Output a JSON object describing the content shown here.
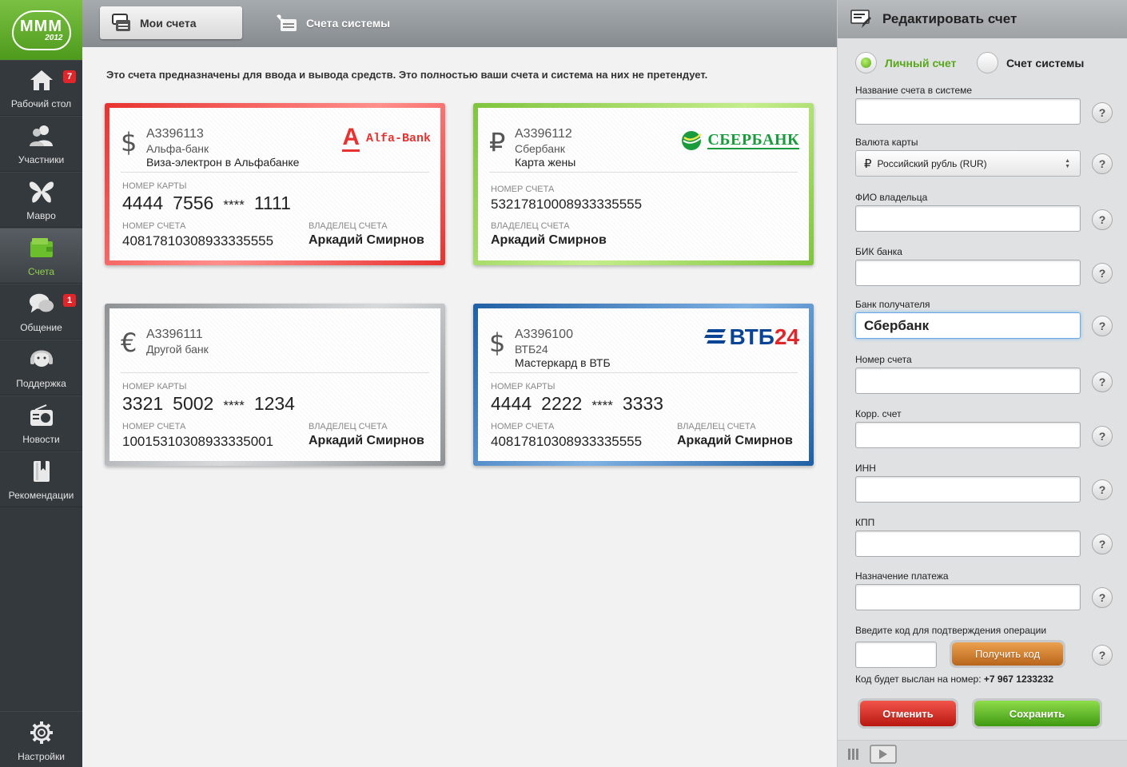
{
  "logo": {
    "text": "МММ",
    "year": "2012"
  },
  "sidebar": {
    "items": [
      {
        "label": "Рабочий стол",
        "icon": "home-icon",
        "badge": "7"
      },
      {
        "label": "Участники",
        "icon": "users-icon",
        "badge": ""
      },
      {
        "label": "Мавро",
        "icon": "butterfly-icon",
        "badge": ""
      },
      {
        "label": "Счета",
        "icon": "wallet-icon",
        "badge": ""
      },
      {
        "label": "Общение",
        "icon": "chat-icon",
        "badge": "1"
      },
      {
        "label": "Поддержка",
        "icon": "headset-icon",
        "badge": ""
      },
      {
        "label": "Новости",
        "icon": "radio-icon",
        "badge": ""
      },
      {
        "label": "Рекомендации",
        "icon": "book-icon",
        "badge": ""
      }
    ],
    "settings_label": "Настройки"
  },
  "tabs": {
    "my": "Мои счета",
    "system": "Счета системы"
  },
  "intro": "Это счета предназначены для ввода и вывода средств. Это полностью ваши счета и система на них не претендует.",
  "cards": {
    "alfa": {
      "currency": "$",
      "id": "A3396113",
      "bank": "Альфа-банк",
      "desc": "Виза-электрон в Альфабанке",
      "card_label": "НОМЕР КАРТЫ",
      "card_number": [
        "4444",
        "7556",
        "****",
        "1111"
      ],
      "account_label": "НОМЕР СЧЕТА",
      "account_number": "40817810308933335555",
      "owner_label": "ВЛАДЕЛЕЦ СЧЕТА",
      "owner": "Аркадий Смирнов",
      "logo_letter": "A",
      "logo_text": "Alfa-Bank",
      "logo_color": "#e8322f"
    },
    "sber": {
      "currency": "₽",
      "id": "A3396112",
      "bank": "Сбербанк",
      "desc": "Карта жены",
      "account_label": "НОМЕР СЧЕТА",
      "account_number": "53217810008933335555",
      "owner_label": "ВЛАДЕЛЕЦ СЧЕТА",
      "owner": "Аркадий Смирнов",
      "logo_text": "СБЕРБАНК",
      "logo_color": "#1a9c3e"
    },
    "other": {
      "currency": "€",
      "id": "A3396111",
      "bank": "Другой банк",
      "card_label": "НОМЕР КАРТЫ",
      "card_number": [
        "3321",
        "5002",
        "****",
        "1234"
      ],
      "account_label": "НОМЕР СЧЕТА",
      "account_number": "10015310308933335001",
      "owner_label": "ВЛАДЕЛЕЦ СЧЕТА",
      "owner": "Аркадий Смирнов"
    },
    "vtb": {
      "currency": "$",
      "id": "A3396100",
      "bank": "ВТБ24",
      "desc": "Мастеркард в ВТБ",
      "card_label": "НОМЕР КАРТЫ",
      "card_number": [
        "4444",
        "2222",
        "****",
        "3333"
      ],
      "account_label": "НОМЕР СЧЕТА",
      "account_number": "40817810308933335555",
      "owner_label": "ВЛАДЕЛЕЦ СЧЕТА",
      "owner": "Аркадий Смирнов",
      "logo_text_a": "ВТБ",
      "logo_text_b": "24",
      "logo_color_a": "#0a4595",
      "logo_color_b": "#e0252b"
    }
  },
  "panel": {
    "title": "Редактировать счет",
    "radio_personal": "Личный счет",
    "radio_system": "Счет системы",
    "fields": {
      "name_label": "Название счета в системе",
      "name_value": "",
      "currency_label": "Валюта карты",
      "currency_value": "Российский рубль (RUR)",
      "currency_symbol": "₽",
      "owner_label": "ФИО владельца",
      "owner_value": "",
      "bik_label": "БИК банка",
      "bik_value": "",
      "bank_label": "Банк получателя",
      "bank_value": "Сбербанк",
      "account_label": "Номер счета",
      "account_value": "",
      "corr_label": "Корр. счет",
      "corr_value": "",
      "inn_label": "ИНН",
      "inn_value": "",
      "kpp_label": "КПП",
      "kpp_value": "",
      "purpose_label": "Назначение платежа",
      "purpose_value": "",
      "code_label": "Введите код для подтверждения операции",
      "code_value": ""
    },
    "help": "?",
    "get_code": "Получить код",
    "code_note_prefix": "Код будет выслан на номер: ",
    "code_note_phone": "+7 967 1233232",
    "cancel": "Отменить",
    "save": "Сохранить"
  },
  "colors": {
    "accent_green": "#7ac143",
    "sidebar": "#34393d",
    "badge_red": "#e0252b"
  }
}
